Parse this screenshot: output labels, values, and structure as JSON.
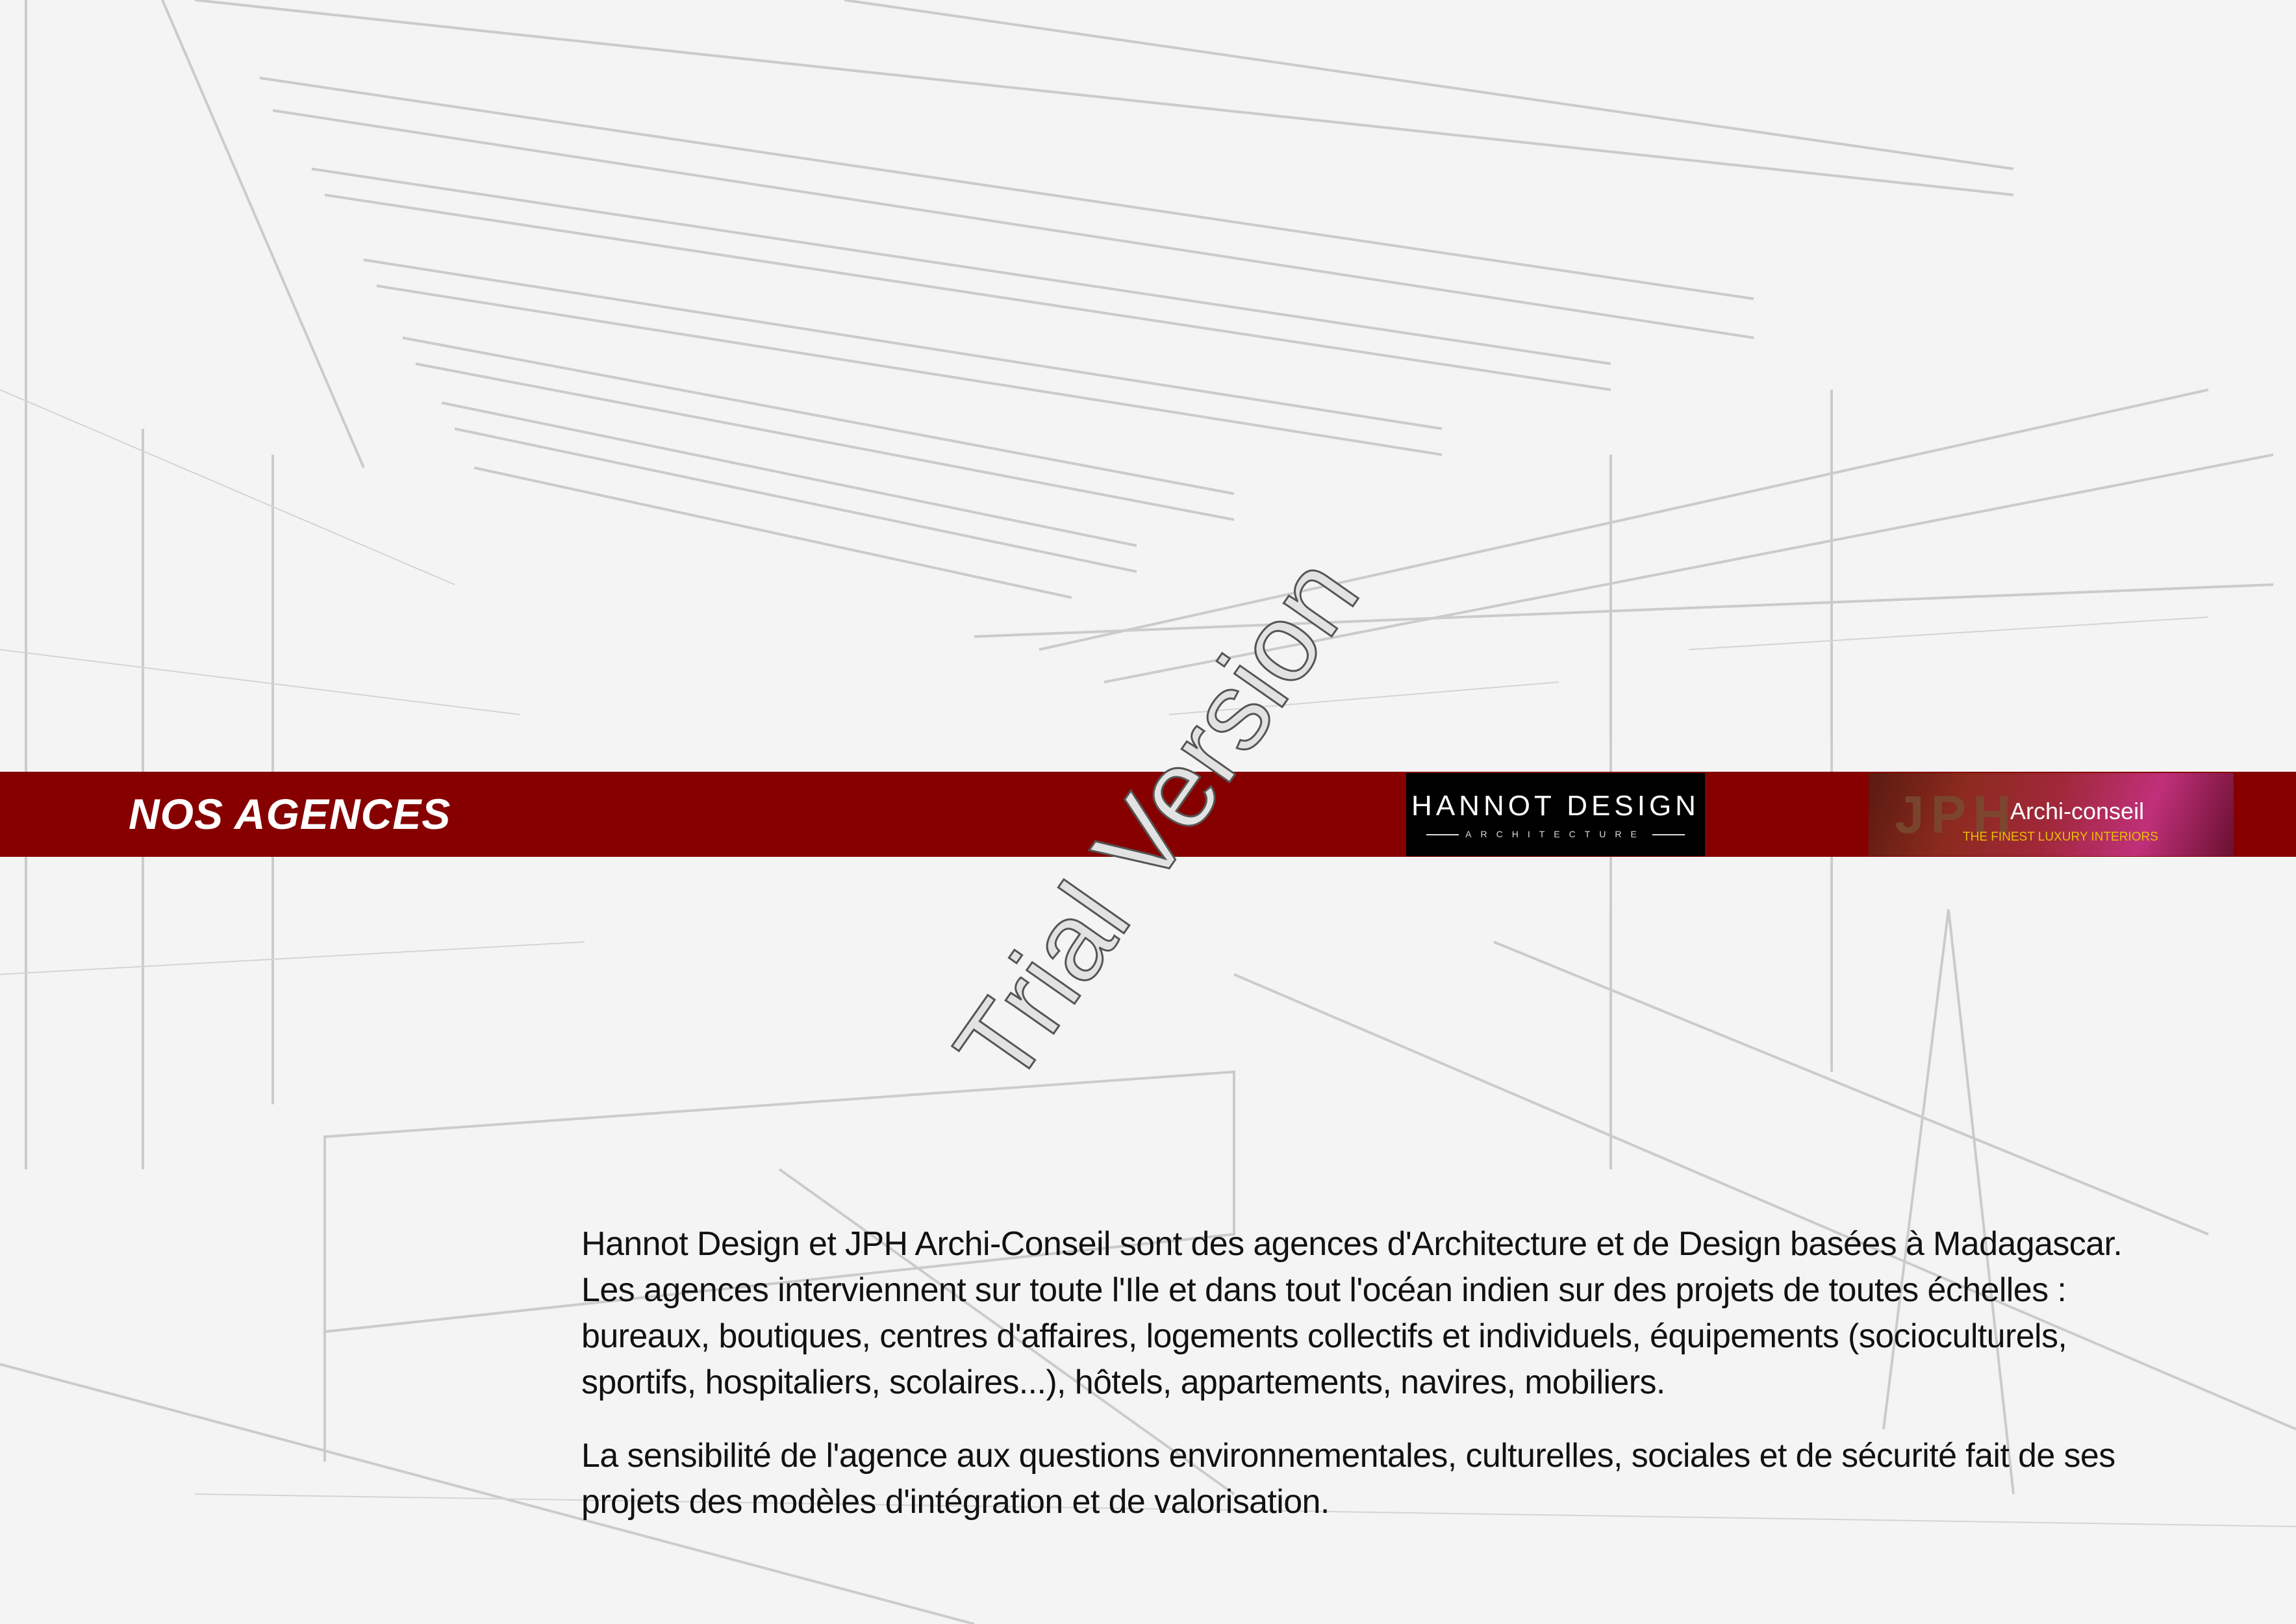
{
  "band": {
    "title": "NOS AGENCES",
    "color": "#870000"
  },
  "logos": {
    "hannot": {
      "name": "HANNOT DESIGN",
      "subtitle": "ARCHITECTURE"
    },
    "jph": {
      "letters": "JPH",
      "name": "Archi-conseil",
      "tagline": "THE FINEST LUXURY INTERIORS"
    }
  },
  "paragraphs": [
    {
      "lines": [
        "Hannot Design et JPH Archi-Conseil sont des agences d'Architecture et de Design basées à Madagascar.",
        "Les agences interviennent sur toute l'Ile et dans tout l'océan indien sur des projets de toutes échelles :",
        "bureaux, boutiques, centres d'affaires, logements collectifs et individuels, équipements (socioculturels,",
        "sportifs, hospitaliers, scolaires...), hôtels, appartements, navires, mobiliers."
      ]
    },
    {
      "lines": [
        "La sensibilité de l'agence aux questions environnementales, culturelles, sociales et de sécurité fait de ses",
        "projets des modèles d'intégration et de valorisation."
      ]
    }
  ],
  "watermark": "Trial Version"
}
